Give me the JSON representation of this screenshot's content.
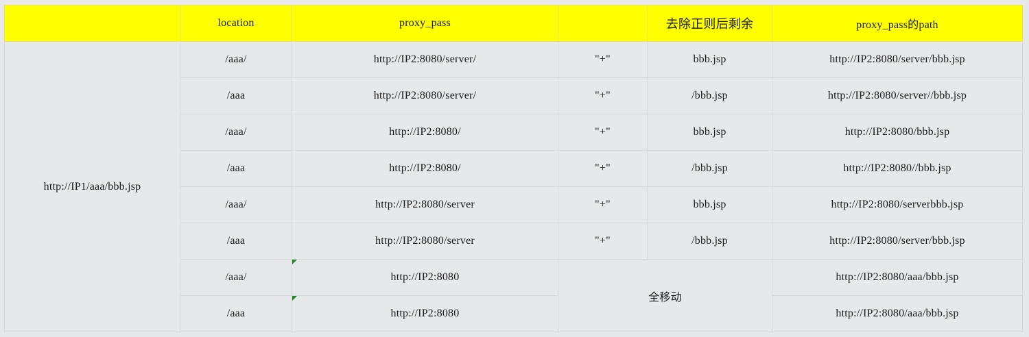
{
  "header": {
    "col0": "",
    "location": "location",
    "proxy_pass": "proxy_pass",
    "op": "",
    "remaining": "去除正则后剩余",
    "path": "proxy_pass的path"
  },
  "request_url": "http://IP1/aaa/bbb.jsp",
  "merged_label": "全移动",
  "rows": [
    {
      "location": "/aaa/",
      "proxy_pass": "http://IP2:8080/server/",
      "op": "\"+\"",
      "remaining": "bbb.jsp",
      "path": "http://IP2:8080/server/bbb.jsp"
    },
    {
      "location": "/aaa",
      "proxy_pass": "http://IP2:8080/server/",
      "op": "\"+\"",
      "remaining": "/bbb.jsp",
      "path": "http://IP2:8080/server//bbb.jsp"
    },
    {
      "location": "/aaa/",
      "proxy_pass": "http://IP2:8080/",
      "op": "\"+\"",
      "remaining": "bbb.jsp",
      "path": "http://IP2:8080/bbb.jsp"
    },
    {
      "location": "/aaa",
      "proxy_pass": "http://IP2:8080/",
      "op": "\"+\"",
      "remaining": "/bbb.jsp",
      "path": "http://IP2:8080//bbb.jsp"
    },
    {
      "location": "/aaa/",
      "proxy_pass": "http://IP2:8080/server",
      "op": "\"+\"",
      "remaining": "bbb.jsp",
      "path": "http://IP2:8080/serverbbb.jsp"
    },
    {
      "location": "/aaa",
      "proxy_pass": "http://IP2:8080/server",
      "op": "\"+\"",
      "remaining": "/bbb.jsp",
      "path": "http://IP2:8080/server/bbb.jsp"
    },
    {
      "location": "/aaa/",
      "proxy_pass": "http://IP2:8080",
      "path": "http://IP2:8080/aaa/bbb.jsp"
    },
    {
      "location": "/aaa",
      "proxy_pass": "http://IP2:8080",
      "path": "http://IP2:8080/aaa/bbb.jsp"
    }
  ],
  "colors": {
    "header_bg": "#ffff00",
    "comment_marker": "#1e8a2a",
    "grid": "#d6dadf"
  }
}
